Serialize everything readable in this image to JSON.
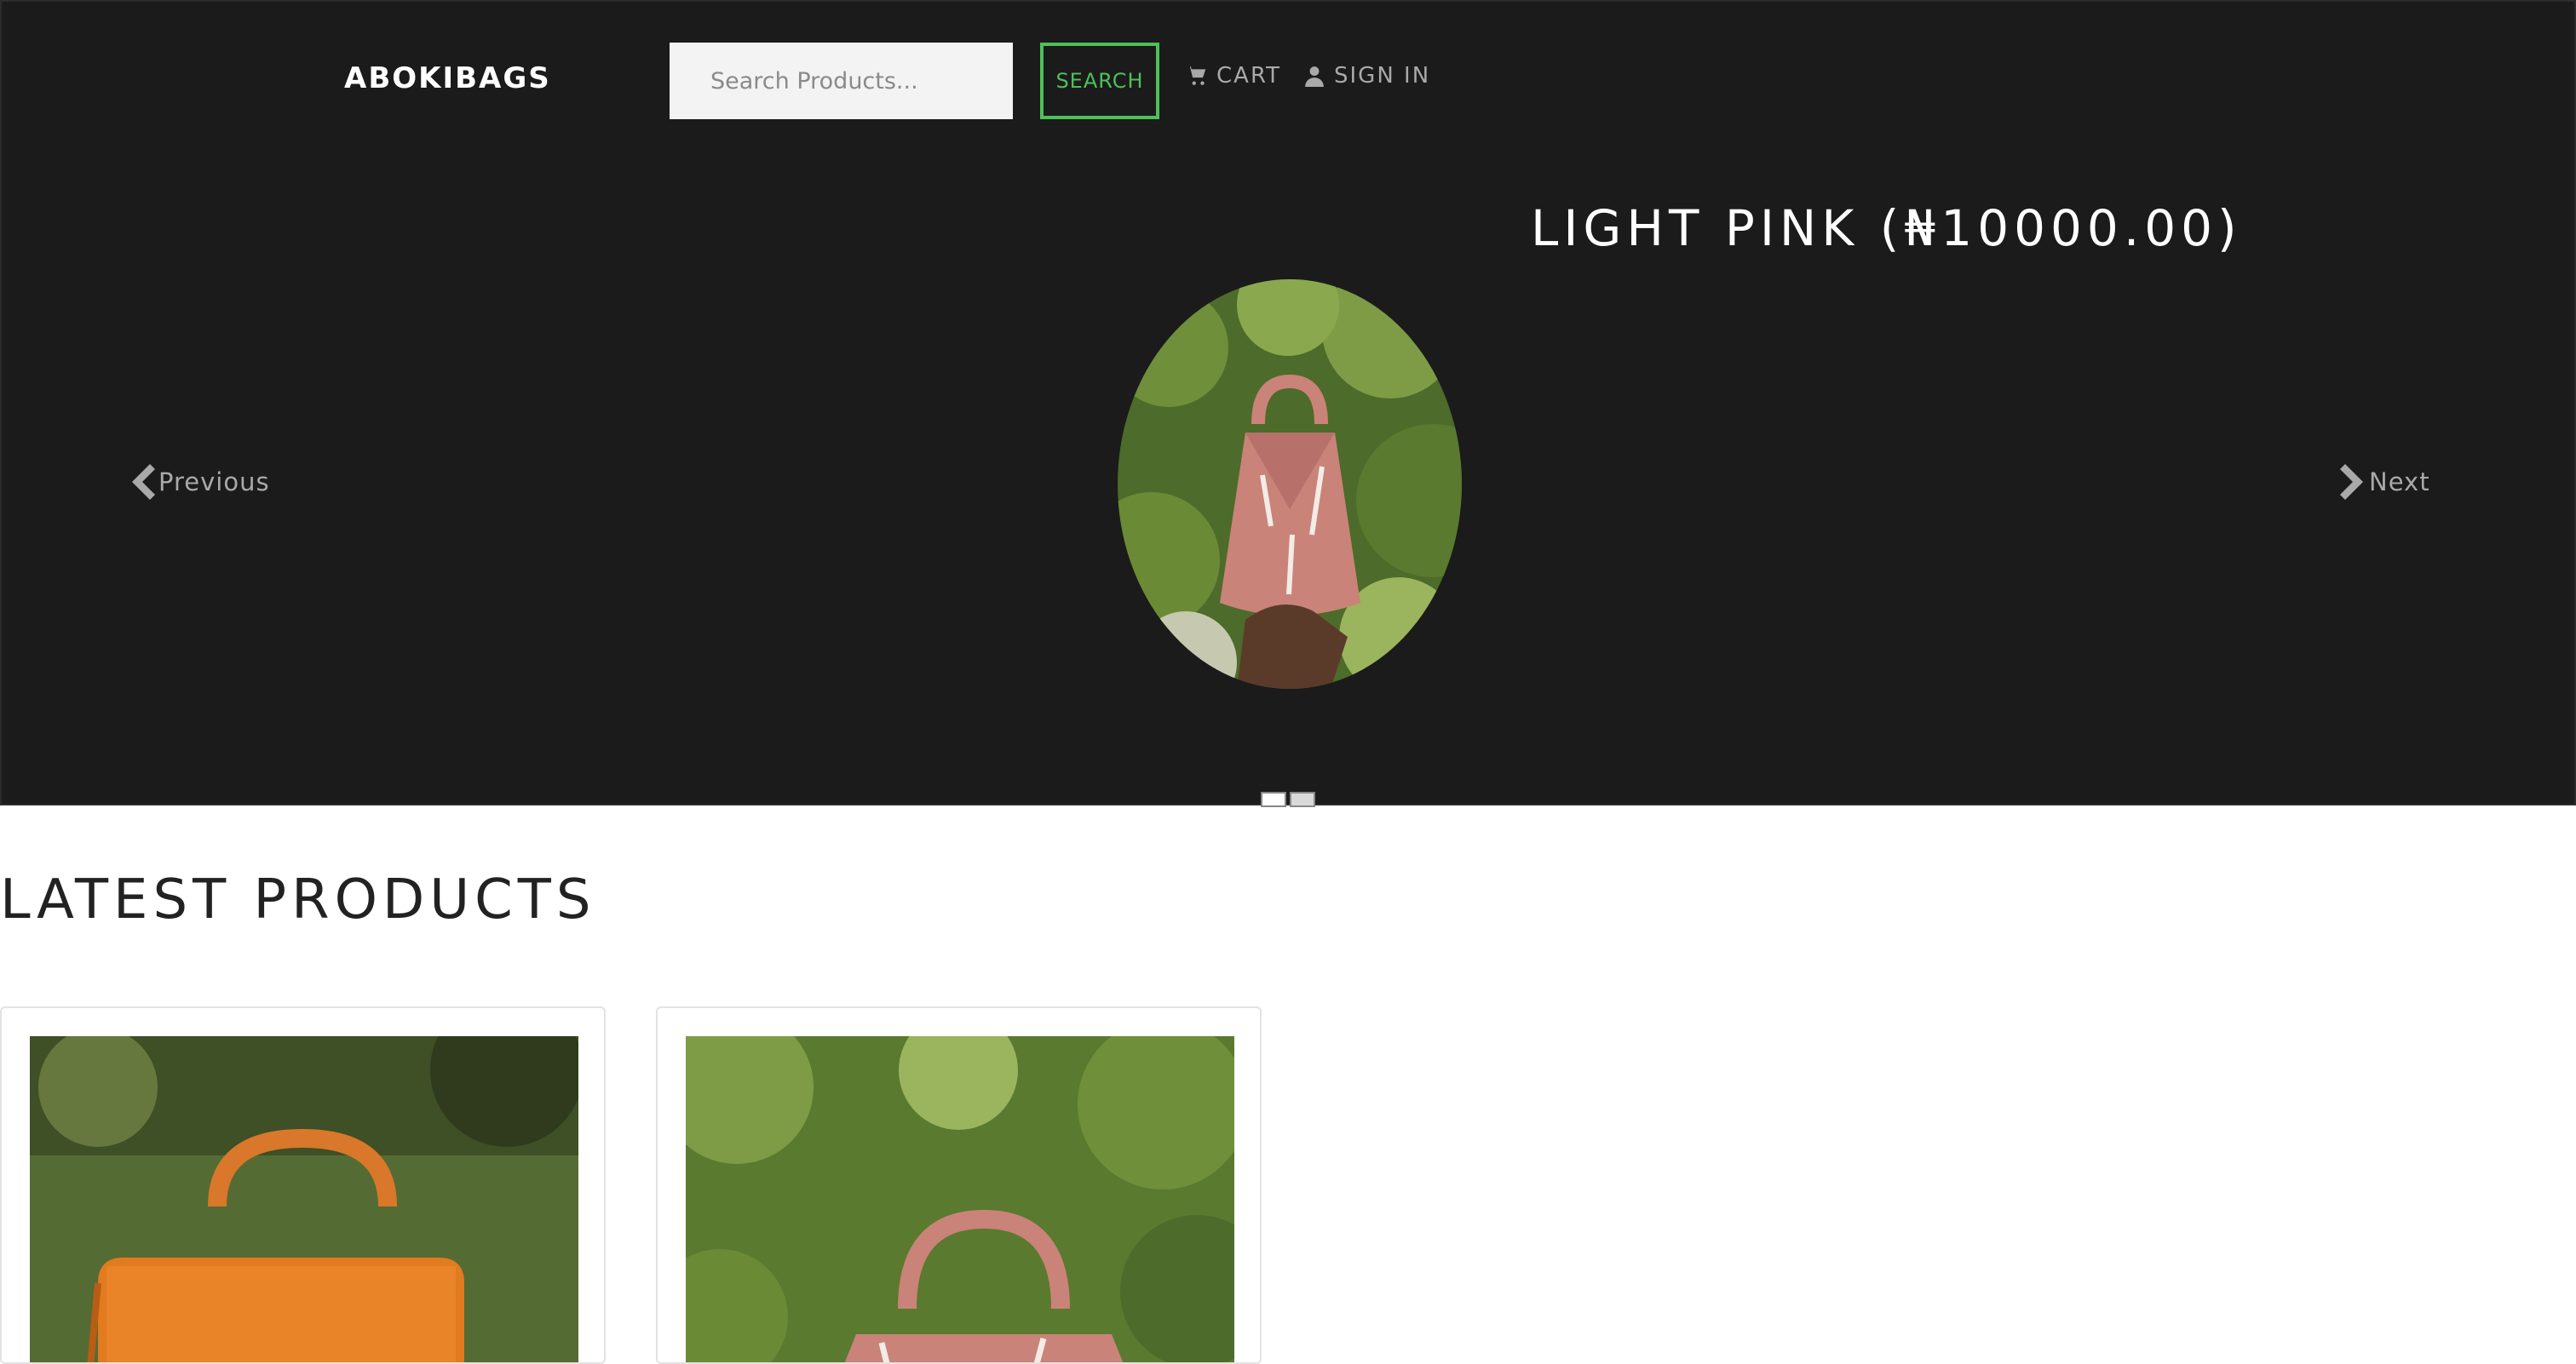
{
  "header": {
    "brand": "ABOKIBAGS",
    "search_placeholder": "Search Products...",
    "search_button": "SEARCH",
    "cart_label": "CART",
    "signin_label": "SIGN IN"
  },
  "carousel": {
    "slide_title": "LIGHT PINK (₦10000.00)",
    "previous_label": "Previous",
    "next_label": "Next",
    "indicator_count": 2,
    "active_indicator": 1
  },
  "latest": {
    "title": "LATEST PRODUCTS",
    "products": [
      {
        "image": "orange-bag-photo"
      },
      {
        "image": "light-pink-bag-photo"
      }
    ]
  },
  "icons": {
    "cart": "cart-icon",
    "user": "user-icon",
    "prev": "chevron-left-icon",
    "next": "chevron-right-icon"
  },
  "colors": {
    "hero_background": "#1b1b1b",
    "accent_green": "#4fbf5a",
    "nav_text": "#a9a9a9"
  }
}
